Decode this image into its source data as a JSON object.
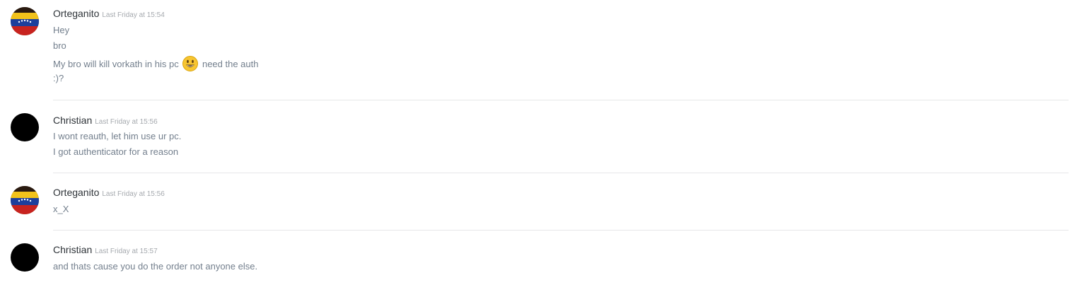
{
  "messages": [
    {
      "author": "Orteganito",
      "timestamp": "Last Friday at 15:54",
      "avatar": "flag-face-avatar",
      "lines": [
        {
          "text": "Hey"
        },
        {
          "text": "bro"
        },
        {
          "before": "My bro will kill vorkath in his pc",
          "emoji": "smiley-emoji",
          "after": "need the auth"
        },
        {
          "text": ":)?"
        }
      ]
    },
    {
      "author": "Christian",
      "timestamp": "Last Friday at 15:56",
      "avatar": "black-circle-avatar",
      "lines": [
        {
          "text": "I wont reauth, let him use ur pc."
        },
        {
          "text": "I got authenticator for a reason"
        }
      ]
    },
    {
      "author": "Orteganito",
      "timestamp": "Last Friday at 15:56",
      "avatar": "flag-face-avatar",
      "lines": [
        {
          "text": "x_X"
        }
      ]
    },
    {
      "author": "Christian",
      "timestamp": "Last Friday at 15:57",
      "avatar": "black-circle-avatar",
      "lines": [
        {
          "text": "and thats cause you do the order not anyone else."
        }
      ]
    }
  ],
  "colors": {
    "username": "#2e3338",
    "timestamp": "#a5a9ae",
    "message_text": "#737f8d",
    "divider": "#e6e7e9"
  }
}
